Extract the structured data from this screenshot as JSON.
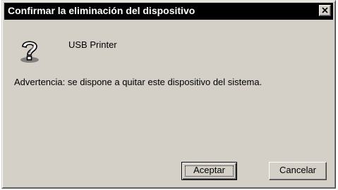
{
  "window": {
    "title": "Confirmar la eliminación del dispositivo",
    "close_icon": "close-icon"
  },
  "dialog": {
    "icon": "question-help-icon",
    "device_name": "USB Printer",
    "warning": "Advertencia: se dispone a quitar este dispositivo del sistema."
  },
  "buttons": {
    "ok_label": "Aceptar",
    "cancel_label": "Cancelar"
  },
  "colors": {
    "face": "#d4d0c8",
    "titlebar": "#000000"
  }
}
